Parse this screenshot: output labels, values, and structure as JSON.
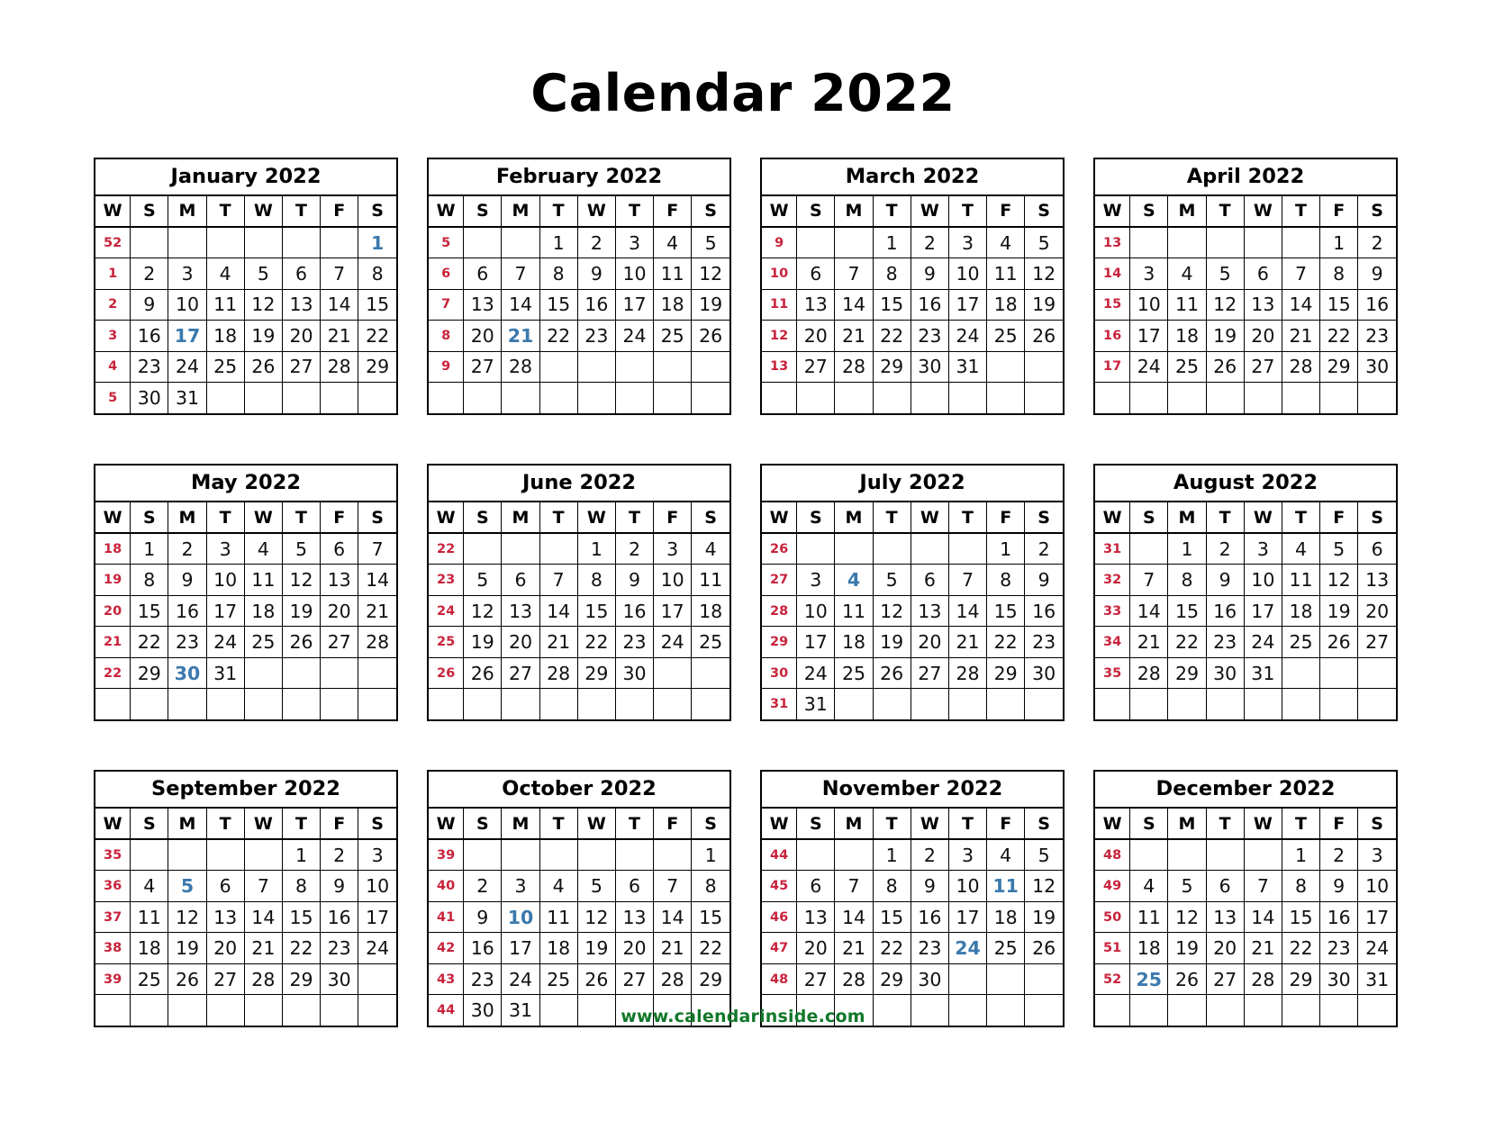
{
  "title": "Calendar 2022",
  "year": "2022",
  "footer": {
    "url_label": "www.calendarinside.com"
  },
  "colors": {
    "week_number": "#c8233c",
    "holiday": "#3b79ad",
    "day": "#111111",
    "title": "#000000",
    "footer": "#11782a",
    "border": "#000000",
    "background": "#ffffff"
  },
  "weekday_headers": [
    "W",
    "S",
    "M",
    "T",
    "W",
    "T",
    "F",
    "S"
  ],
  "months": [
    {
      "name": "January 2022",
      "weeks": [
        {
          "week": "52",
          "days": [
            "",
            "",
            "",
            "",
            "",
            "",
            "1"
          ],
          "holidays": [
            "1"
          ]
        },
        {
          "week": "1",
          "days": [
            "2",
            "3",
            "4",
            "5",
            "6",
            "7",
            "8"
          ],
          "holidays": []
        },
        {
          "week": "2",
          "days": [
            "9",
            "10",
            "11",
            "12",
            "13",
            "14",
            "15"
          ],
          "holidays": []
        },
        {
          "week": "3",
          "days": [
            "16",
            "17",
            "18",
            "19",
            "20",
            "21",
            "22"
          ],
          "holidays": [
            "17"
          ]
        },
        {
          "week": "4",
          "days": [
            "23",
            "24",
            "25",
            "26",
            "27",
            "28",
            "29"
          ],
          "holidays": []
        },
        {
          "week": "5",
          "days": [
            "30",
            "31",
            "",
            "",
            "",
            "",
            ""
          ],
          "holidays": []
        }
      ]
    },
    {
      "name": "February 2022",
      "weeks": [
        {
          "week": "5",
          "days": [
            "",
            "",
            "1",
            "2",
            "3",
            "4",
            "5"
          ],
          "holidays": []
        },
        {
          "week": "6",
          "days": [
            "6",
            "7",
            "8",
            "9",
            "10",
            "11",
            "12"
          ],
          "holidays": []
        },
        {
          "week": "7",
          "days": [
            "13",
            "14",
            "15",
            "16",
            "17",
            "18",
            "19"
          ],
          "holidays": []
        },
        {
          "week": "8",
          "days": [
            "20",
            "21",
            "22",
            "23",
            "24",
            "25",
            "26"
          ],
          "holidays": [
            "21"
          ]
        },
        {
          "week": "9",
          "days": [
            "27",
            "28",
            "",
            "",
            "",
            "",
            ""
          ],
          "holidays": []
        },
        {
          "week": "",
          "days": [
            "",
            "",
            "",
            "",
            "",
            "",
            ""
          ],
          "holidays": []
        }
      ]
    },
    {
      "name": "March 2022",
      "weeks": [
        {
          "week": "9",
          "days": [
            "",
            "",
            "1",
            "2",
            "3",
            "4",
            "5"
          ],
          "holidays": []
        },
        {
          "week": "10",
          "days": [
            "6",
            "7",
            "8",
            "9",
            "10",
            "11",
            "12"
          ],
          "holidays": []
        },
        {
          "week": "11",
          "days": [
            "13",
            "14",
            "15",
            "16",
            "17",
            "18",
            "19"
          ],
          "holidays": []
        },
        {
          "week": "12",
          "days": [
            "20",
            "21",
            "22",
            "23",
            "24",
            "25",
            "26"
          ],
          "holidays": []
        },
        {
          "week": "13",
          "days": [
            "27",
            "28",
            "29",
            "30",
            "31",
            "",
            ""
          ],
          "holidays": []
        },
        {
          "week": "",
          "days": [
            "",
            "",
            "",
            "",
            "",
            "",
            ""
          ],
          "holidays": []
        }
      ]
    },
    {
      "name": "April 2022",
      "weeks": [
        {
          "week": "13",
          "days": [
            "",
            "",
            "",
            "",
            "",
            "1",
            "2"
          ],
          "holidays": []
        },
        {
          "week": "14",
          "days": [
            "3",
            "4",
            "5",
            "6",
            "7",
            "8",
            "9"
          ],
          "holidays": []
        },
        {
          "week": "15",
          "days": [
            "10",
            "11",
            "12",
            "13",
            "14",
            "15",
            "16"
          ],
          "holidays": []
        },
        {
          "week": "16",
          "days": [
            "17",
            "18",
            "19",
            "20",
            "21",
            "22",
            "23"
          ],
          "holidays": []
        },
        {
          "week": "17",
          "days": [
            "24",
            "25",
            "26",
            "27",
            "28",
            "29",
            "30"
          ],
          "holidays": []
        },
        {
          "week": "",
          "days": [
            "",
            "",
            "",
            "",
            "",
            "",
            ""
          ],
          "holidays": []
        }
      ]
    },
    {
      "name": "May 2022",
      "weeks": [
        {
          "week": "18",
          "days": [
            "1",
            "2",
            "3",
            "4",
            "5",
            "6",
            "7"
          ],
          "holidays": []
        },
        {
          "week": "19",
          "days": [
            "8",
            "9",
            "10",
            "11",
            "12",
            "13",
            "14"
          ],
          "holidays": []
        },
        {
          "week": "20",
          "days": [
            "15",
            "16",
            "17",
            "18",
            "19",
            "20",
            "21"
          ],
          "holidays": []
        },
        {
          "week": "21",
          "days": [
            "22",
            "23",
            "24",
            "25",
            "26",
            "27",
            "28"
          ],
          "holidays": []
        },
        {
          "week": "22",
          "days": [
            "29",
            "30",
            "31",
            "",
            "",
            "",
            ""
          ],
          "holidays": [
            "30"
          ]
        },
        {
          "week": "",
          "days": [
            "",
            "",
            "",
            "",
            "",
            "",
            ""
          ],
          "holidays": []
        }
      ]
    },
    {
      "name": "June 2022",
      "weeks": [
        {
          "week": "22",
          "days": [
            "",
            "",
            "",
            "1",
            "2",
            "3",
            "4"
          ],
          "holidays": []
        },
        {
          "week": "23",
          "days": [
            "5",
            "6",
            "7",
            "8",
            "9",
            "10",
            "11"
          ],
          "holidays": []
        },
        {
          "week": "24",
          "days": [
            "12",
            "13",
            "14",
            "15",
            "16",
            "17",
            "18"
          ],
          "holidays": []
        },
        {
          "week": "25",
          "days": [
            "19",
            "20",
            "21",
            "22",
            "23",
            "24",
            "25"
          ],
          "holidays": []
        },
        {
          "week": "26",
          "days": [
            "26",
            "27",
            "28",
            "29",
            "30",
            "",
            ""
          ],
          "holidays": []
        },
        {
          "week": "",
          "days": [
            "",
            "",
            "",
            "",
            "",
            "",
            ""
          ],
          "holidays": []
        }
      ]
    },
    {
      "name": "July 2022",
      "weeks": [
        {
          "week": "26",
          "days": [
            "",
            "",
            "",
            "",
            "",
            "1",
            "2"
          ],
          "holidays": []
        },
        {
          "week": "27",
          "days": [
            "3",
            "4",
            "5",
            "6",
            "7",
            "8",
            "9"
          ],
          "holidays": [
            "4"
          ]
        },
        {
          "week": "28",
          "days": [
            "10",
            "11",
            "12",
            "13",
            "14",
            "15",
            "16"
          ],
          "holidays": []
        },
        {
          "week": "29",
          "days": [
            "17",
            "18",
            "19",
            "20",
            "21",
            "22",
            "23"
          ],
          "holidays": []
        },
        {
          "week": "30",
          "days": [
            "24",
            "25",
            "26",
            "27",
            "28",
            "29",
            "30"
          ],
          "holidays": []
        },
        {
          "week": "31",
          "days": [
            "31",
            "",
            "",
            "",
            "",
            "",
            ""
          ],
          "holidays": []
        }
      ]
    },
    {
      "name": "August 2022",
      "weeks": [
        {
          "week": "31",
          "days": [
            "",
            "1",
            "2",
            "3",
            "4",
            "5",
            "6"
          ],
          "holidays": []
        },
        {
          "week": "32",
          "days": [
            "7",
            "8",
            "9",
            "10",
            "11",
            "12",
            "13"
          ],
          "holidays": []
        },
        {
          "week": "33",
          "days": [
            "14",
            "15",
            "16",
            "17",
            "18",
            "19",
            "20"
          ],
          "holidays": []
        },
        {
          "week": "34",
          "days": [
            "21",
            "22",
            "23",
            "24",
            "25",
            "26",
            "27"
          ],
          "holidays": []
        },
        {
          "week": "35",
          "days": [
            "28",
            "29",
            "30",
            "31",
            "",
            "",
            ""
          ],
          "holidays": []
        },
        {
          "week": "",
          "days": [
            "",
            "",
            "",
            "",
            "",
            "",
            ""
          ],
          "holidays": []
        }
      ]
    },
    {
      "name": "September 2022",
      "weeks": [
        {
          "week": "35",
          "days": [
            "",
            "",
            "",
            "",
            "1",
            "2",
            "3"
          ],
          "holidays": []
        },
        {
          "week": "36",
          "days": [
            "4",
            "5",
            "6",
            "7",
            "8",
            "9",
            "10"
          ],
          "holidays": [
            "5"
          ]
        },
        {
          "week": "37",
          "days": [
            "11",
            "12",
            "13",
            "14",
            "15",
            "16",
            "17"
          ],
          "holidays": []
        },
        {
          "week": "38",
          "days": [
            "18",
            "19",
            "20",
            "21",
            "22",
            "23",
            "24"
          ],
          "holidays": []
        },
        {
          "week": "39",
          "days": [
            "25",
            "26",
            "27",
            "28",
            "29",
            "30",
            ""
          ],
          "holidays": []
        },
        {
          "week": "",
          "days": [
            "",
            "",
            "",
            "",
            "",
            "",
            ""
          ],
          "holidays": []
        }
      ]
    },
    {
      "name": "October 2022",
      "weeks": [
        {
          "week": "39",
          "days": [
            "",
            "",
            "",
            "",
            "",
            "",
            "1"
          ],
          "holidays": []
        },
        {
          "week": "40",
          "days": [
            "2",
            "3",
            "4",
            "5",
            "6",
            "7",
            "8"
          ],
          "holidays": []
        },
        {
          "week": "41",
          "days": [
            "9",
            "10",
            "11",
            "12",
            "13",
            "14",
            "15"
          ],
          "holidays": [
            "10"
          ]
        },
        {
          "week": "42",
          "days": [
            "16",
            "17",
            "18",
            "19",
            "20",
            "21",
            "22"
          ],
          "holidays": []
        },
        {
          "week": "43",
          "days": [
            "23",
            "24",
            "25",
            "26",
            "27",
            "28",
            "29"
          ],
          "holidays": []
        },
        {
          "week": "44",
          "days": [
            "30",
            "31",
            "",
            "",
            "",
            "",
            ""
          ],
          "holidays": []
        }
      ]
    },
    {
      "name": "November 2022",
      "weeks": [
        {
          "week": "44",
          "days": [
            "",
            "",
            "1",
            "2",
            "3",
            "4",
            "5"
          ],
          "holidays": []
        },
        {
          "week": "45",
          "days": [
            "6",
            "7",
            "8",
            "9",
            "10",
            "11",
            "12"
          ],
          "holidays": [
            "11"
          ]
        },
        {
          "week": "46",
          "days": [
            "13",
            "14",
            "15",
            "16",
            "17",
            "18",
            "19"
          ],
          "holidays": []
        },
        {
          "week": "47",
          "days": [
            "20",
            "21",
            "22",
            "23",
            "24",
            "25",
            "26"
          ],
          "holidays": [
            "24"
          ]
        },
        {
          "week": "48",
          "days": [
            "27",
            "28",
            "29",
            "30",
            "",
            "",
            ""
          ],
          "holidays": []
        },
        {
          "week": "",
          "days": [
            "",
            "",
            "",
            "",
            "",
            "",
            ""
          ],
          "holidays": []
        }
      ]
    },
    {
      "name": "December 2022",
      "weeks": [
        {
          "week": "48",
          "days": [
            "",
            "",
            "",
            "",
            "1",
            "2",
            "3"
          ],
          "holidays": []
        },
        {
          "week": "49",
          "days": [
            "4",
            "5",
            "6",
            "7",
            "8",
            "9",
            "10"
          ],
          "holidays": []
        },
        {
          "week": "50",
          "days": [
            "11",
            "12",
            "13",
            "14",
            "15",
            "16",
            "17"
          ],
          "holidays": []
        },
        {
          "week": "51",
          "days": [
            "18",
            "19",
            "20",
            "21",
            "22",
            "23",
            "24"
          ],
          "holidays": []
        },
        {
          "week": "52",
          "days": [
            "25",
            "26",
            "27",
            "28",
            "29",
            "30",
            "31"
          ],
          "holidays": [
            "25"
          ]
        },
        {
          "week": "",
          "days": [
            "",
            "",
            "",
            "",
            "",
            "",
            ""
          ],
          "holidays": []
        }
      ]
    }
  ]
}
